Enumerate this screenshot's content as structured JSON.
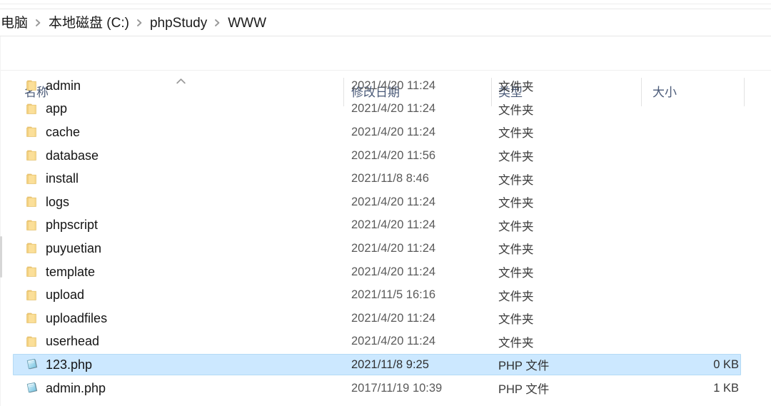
{
  "window": {
    "type": "windows-file-explorer"
  },
  "breadcrumb": {
    "name": "address-breadcrumb",
    "separator_icon": "chevron-right-icon",
    "items": [
      {
        "label": "电脑"
      },
      {
        "label": "本地磁盘 (C:)"
      },
      {
        "label": "phpStudy"
      },
      {
        "label": "WWW"
      }
    ]
  },
  "columns": {
    "sort_indicator": "sort-ascending-caret",
    "sorted_by": "名称",
    "headers": [
      {
        "key": "name",
        "label": "名称"
      },
      {
        "key": "date",
        "label": "修改日期"
      },
      {
        "key": "type",
        "label": "类型"
      },
      {
        "key": "size",
        "label": "大小"
      }
    ]
  },
  "colors": {
    "selection_fill": "#cce8ff",
    "selection_border": "#b4daf5",
    "header_text": "#4a5a78",
    "folder_icon": "#f6d992",
    "php_icon": "#9fd4e8"
  },
  "files": {
    "name": "file-list",
    "rows": [
      {
        "icon": "folder-icon",
        "name": "admin",
        "date": "2021/4/20 11:24",
        "type": "文件夹",
        "size": "",
        "selected": false
      },
      {
        "icon": "folder-icon",
        "name": "app",
        "date": "2021/4/20 11:24",
        "type": "文件夹",
        "size": "",
        "selected": false
      },
      {
        "icon": "folder-icon",
        "name": "cache",
        "date": "2021/4/20 11:24",
        "type": "文件夹",
        "size": "",
        "selected": false
      },
      {
        "icon": "folder-icon",
        "name": "database",
        "date": "2021/4/20 11:56",
        "type": "文件夹",
        "size": "",
        "selected": false
      },
      {
        "icon": "folder-icon",
        "name": "install",
        "date": "2021/11/8 8:46",
        "type": "文件夹",
        "size": "",
        "selected": false
      },
      {
        "icon": "folder-icon",
        "name": "logs",
        "date": "2021/4/20 11:24",
        "type": "文件夹",
        "size": "",
        "selected": false
      },
      {
        "icon": "folder-icon",
        "name": "phpscript",
        "date": "2021/4/20 11:24",
        "type": "文件夹",
        "size": "",
        "selected": false
      },
      {
        "icon": "folder-icon",
        "name": "puyuetian",
        "date": "2021/4/20 11:24",
        "type": "文件夹",
        "size": "",
        "selected": false
      },
      {
        "icon": "folder-icon",
        "name": "template",
        "date": "2021/4/20 11:24",
        "type": "文件夹",
        "size": "",
        "selected": false
      },
      {
        "icon": "folder-icon",
        "name": "upload",
        "date": "2021/11/5 16:16",
        "type": "文件夹",
        "size": "",
        "selected": false
      },
      {
        "icon": "folder-icon",
        "name": "uploadfiles",
        "date": "2021/4/20 11:24",
        "type": "文件夹",
        "size": "",
        "selected": false
      },
      {
        "icon": "folder-icon",
        "name": "userhead",
        "date": "2021/4/20 11:24",
        "type": "文件夹",
        "size": "",
        "selected": false
      },
      {
        "icon": "php-file-icon",
        "name": "123.php",
        "date": "2021/11/8 9:25",
        "type": "PHP 文件",
        "size": "0 KB",
        "selected": true
      },
      {
        "icon": "php-file-icon",
        "name": "admin.php",
        "date": "2017/11/19 10:39",
        "type": "PHP 文件",
        "size": "1 KB",
        "selected": false
      }
    ]
  }
}
